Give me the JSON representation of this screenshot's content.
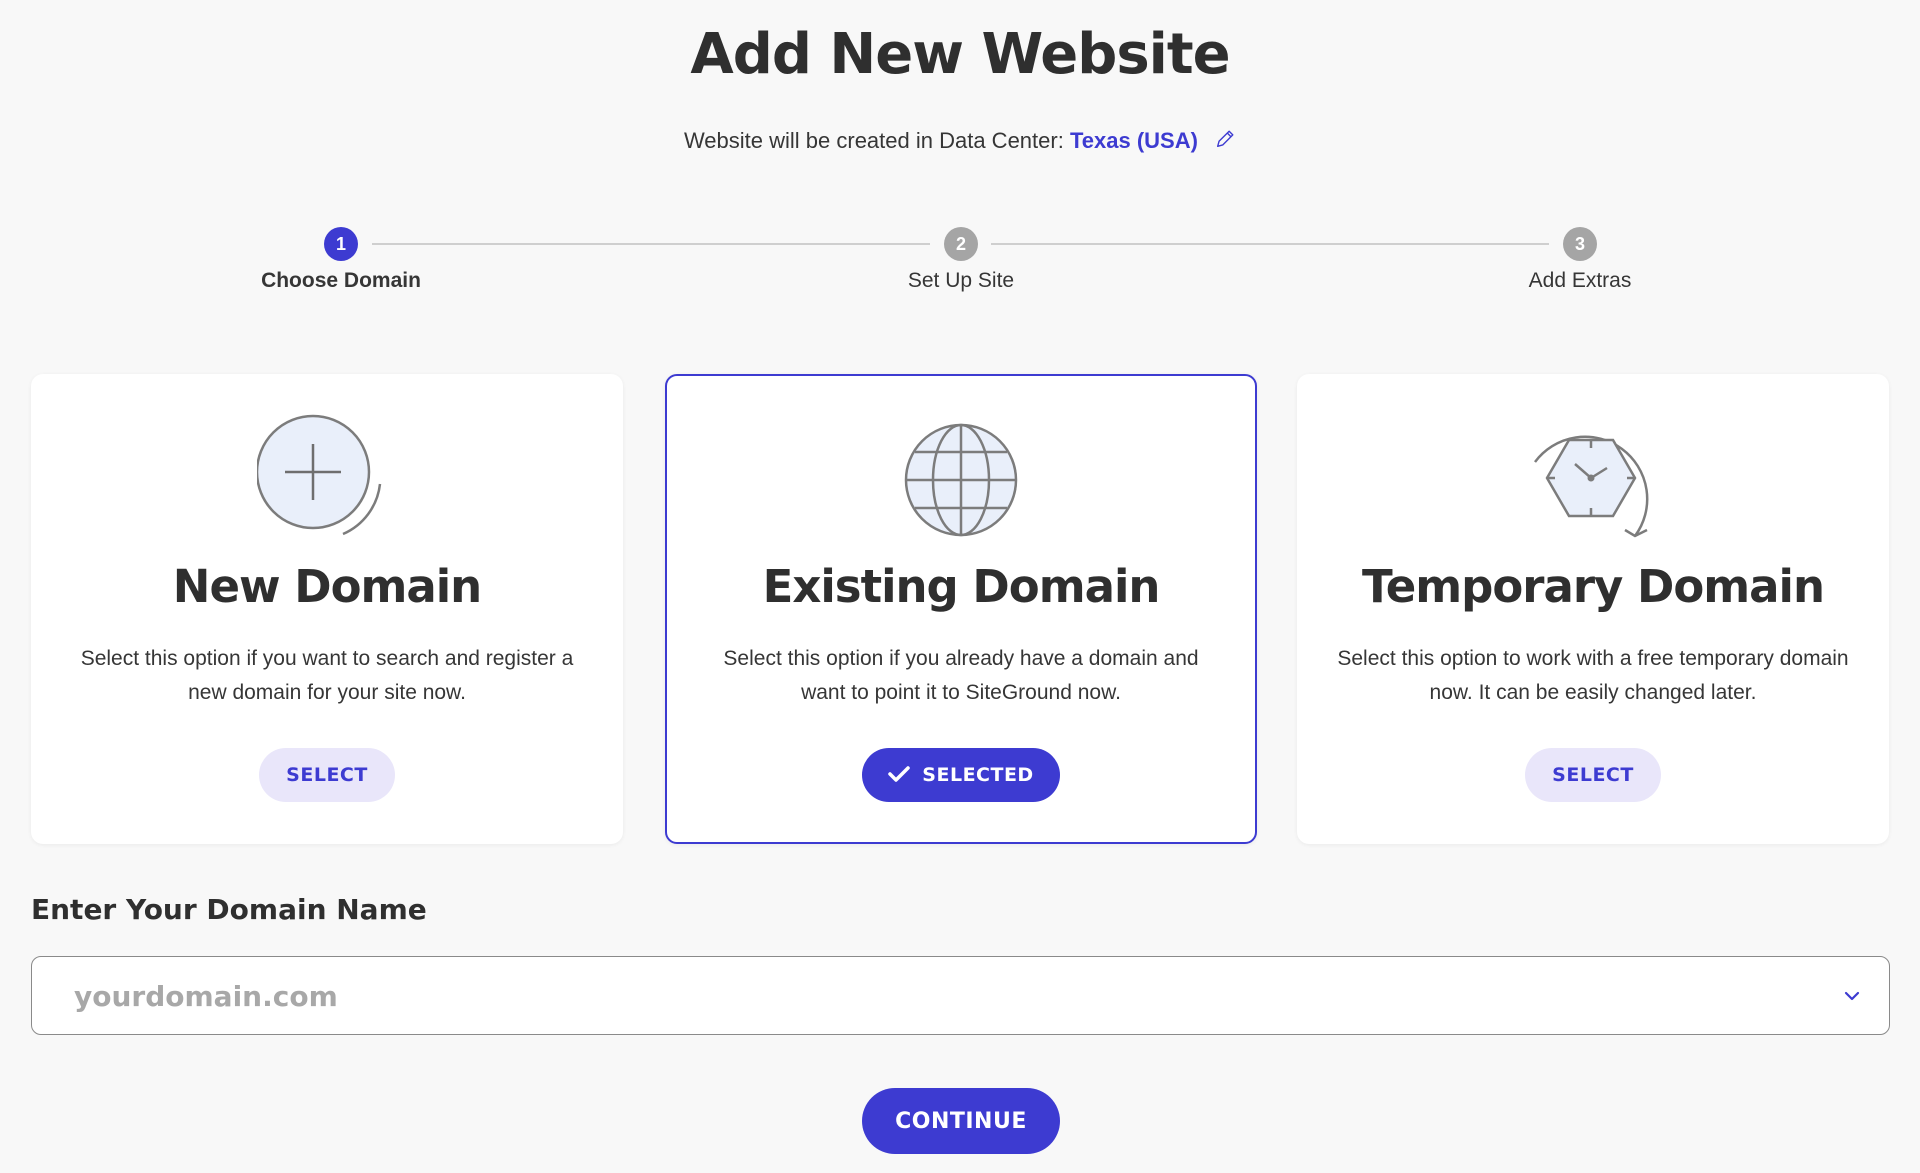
{
  "page": {
    "title": "Add New Website",
    "datacenter_prefix": "Website will be created in Data Center:",
    "datacenter_value": "Texas (USA)",
    "edit_icon": "pencil-icon"
  },
  "stepper": {
    "steps": [
      {
        "number": "1",
        "label": "Choose Domain",
        "state": "active"
      },
      {
        "number": "2",
        "label": "Set Up Site",
        "state": "inactive"
      },
      {
        "number": "3",
        "label": "Add Extras",
        "state": "inactive"
      }
    ]
  },
  "options": [
    {
      "icon": "add-circle-icon",
      "title": "New Domain",
      "description": "Select this option if you want to search and register a new domain for your site now.",
      "button": "SELECT",
      "selected": false
    },
    {
      "icon": "globe-icon",
      "title": "Existing Domain",
      "description": "Select this option if you already have a domain and want to point it to SiteGround now.",
      "button": "SELECTED",
      "selected": true
    },
    {
      "icon": "clock-hexagon-icon",
      "title": "Temporary Domain",
      "description": "Select this option to work with a free temporary domain now. It can be easily changed later.",
      "button": "SELECT",
      "selected": false
    }
  ],
  "domain": {
    "label": "Enter Your Domain Name",
    "value": "",
    "placeholder": "yourdomain.com"
  },
  "continue_label": "CONTINUE",
  "colors": {
    "accent": "#3d3bd1",
    "accent_light": "#e9e6fa",
    "inactive_step": "#a5a5a5",
    "background": "#f8f8f8"
  }
}
